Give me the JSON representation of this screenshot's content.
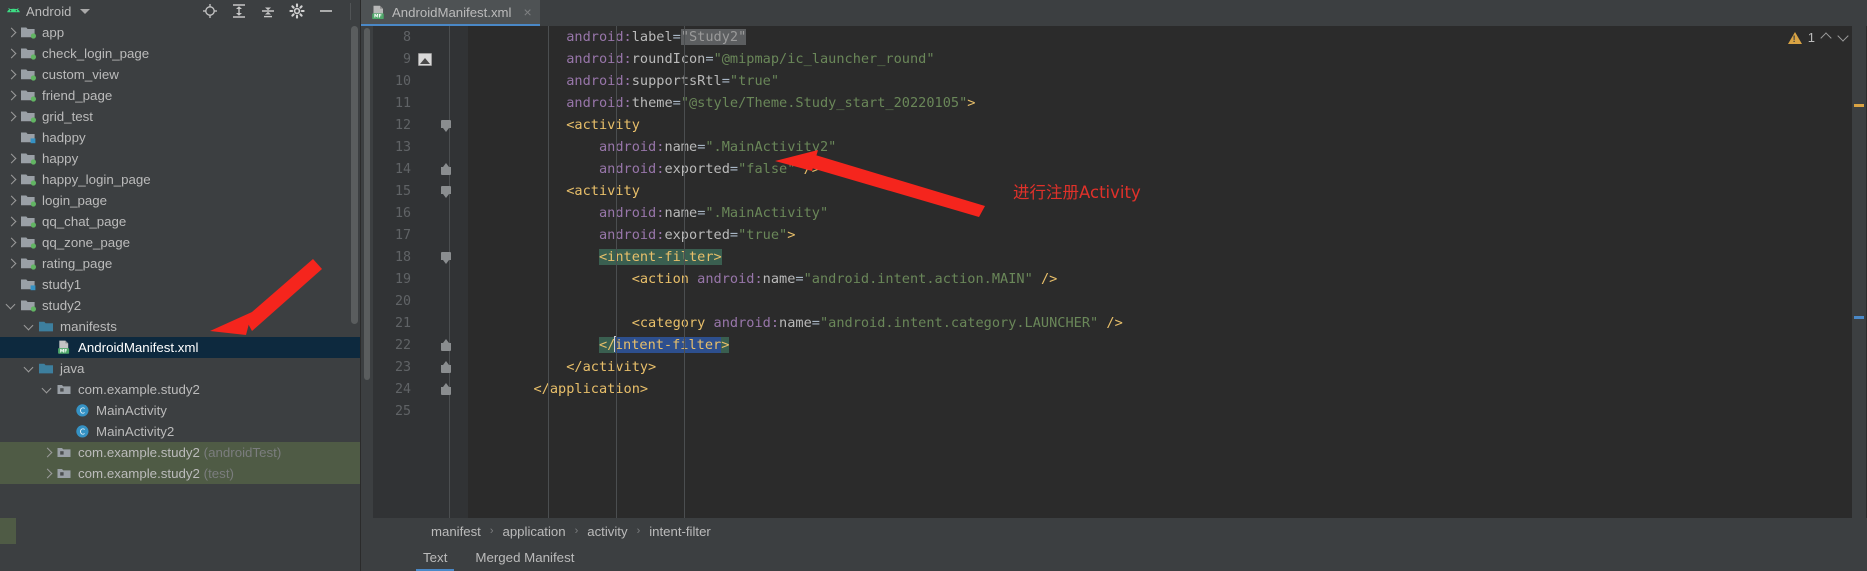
{
  "window": {
    "panel_title": "Android",
    "panel_caret": "▾"
  },
  "toolbar": {
    "icons": [
      {
        "name": "locate-target-icon",
        "glyph": "target"
      },
      {
        "name": "expand-all-icon",
        "glyph": "expand"
      },
      {
        "name": "collapse-all-icon",
        "glyph": "collapse"
      },
      {
        "name": "settings-gear-icon",
        "glyph": "gear"
      },
      {
        "name": "hide-panel-icon",
        "glyph": "minus"
      }
    ]
  },
  "sidebar": {
    "items": [
      {
        "label": "app",
        "twisty": "right",
        "icon": "module-folder-icon",
        "indent": 0,
        "state": "normal"
      },
      {
        "label": "check_login_page",
        "twisty": "right",
        "icon": "module-folder-icon",
        "indent": 0,
        "state": "normal"
      },
      {
        "label": "custom_view",
        "twisty": "right",
        "icon": "module-folder-icon",
        "indent": 0,
        "state": "normal"
      },
      {
        "label": "friend_page",
        "twisty": "right",
        "icon": "module-folder-icon",
        "indent": 0,
        "state": "normal"
      },
      {
        "label": "grid_test",
        "twisty": "right",
        "icon": "module-folder-icon",
        "indent": 0,
        "state": "normal"
      },
      {
        "label": "hadppy",
        "twisty": "none",
        "icon": "module-folder-blue-icon",
        "indent": 0,
        "state": "normal"
      },
      {
        "label": "happy",
        "twisty": "right",
        "icon": "module-folder-icon",
        "indent": 0,
        "state": "normal"
      },
      {
        "label": "happy_login_page",
        "twisty": "right",
        "icon": "module-folder-icon",
        "indent": 0,
        "state": "normal"
      },
      {
        "label": "login_page",
        "twisty": "right",
        "icon": "module-folder-icon",
        "indent": 0,
        "state": "normal"
      },
      {
        "label": "qq_chat_page",
        "twisty": "right",
        "icon": "module-folder-icon",
        "indent": 0,
        "state": "normal"
      },
      {
        "label": "qq_zone_page",
        "twisty": "right",
        "icon": "module-folder-icon",
        "indent": 0,
        "state": "normal"
      },
      {
        "label": "rating_page",
        "twisty": "right",
        "icon": "module-folder-icon",
        "indent": 0,
        "state": "normal"
      },
      {
        "label": "study1",
        "twisty": "none",
        "icon": "module-folder-blue-icon",
        "indent": 0,
        "state": "normal"
      },
      {
        "label": "study2",
        "twisty": "down",
        "icon": "module-folder-icon",
        "indent": 0,
        "state": "normal"
      },
      {
        "label": "manifests",
        "twisty": "down",
        "icon": "folder-icon",
        "indent": 1,
        "state": "normal"
      },
      {
        "label": "AndroidManifest.xml",
        "twisty": "none",
        "icon": "manifest-file-icon",
        "indent": 2,
        "state": "selected"
      },
      {
        "label": "java",
        "twisty": "down",
        "icon": "folder-icon",
        "indent": 1,
        "state": "normal"
      },
      {
        "label": "com.example.study2",
        "twisty": "down",
        "icon": "package-icon",
        "indent": 2,
        "state": "normal"
      },
      {
        "label": "MainActivity",
        "twisty": "none",
        "icon": "java-class-icon",
        "indent": 3,
        "state": "normal"
      },
      {
        "label": "MainActivity2",
        "twisty": "none",
        "icon": "java-class-icon",
        "indent": 3,
        "state": "normal"
      },
      {
        "label": "com.example.study2",
        "suffix": " (androidTest)",
        "twisty": "right",
        "icon": "package-icon",
        "indent": 2,
        "state": "testsrc"
      },
      {
        "label": "com.example.study2",
        "suffix": " (test)",
        "twisty": "right",
        "icon": "package-icon",
        "indent": 2,
        "state": "testsrc"
      }
    ]
  },
  "editor": {
    "tab": {
      "label": "AndroidManifest.xml",
      "close_glyph": "×",
      "icon": "manifest-file-icon"
    },
    "first_line_number": 8,
    "lines": [
      {
        "num": 8,
        "fold": "none",
        "gutter_icon": "none",
        "segments": [
          {
            "t": "            ",
            "c": "plain"
          },
          {
            "t": "android:",
            "c": "attr"
          },
          {
            "t": "label",
            "c": "attrns"
          },
          {
            "t": "=",
            "c": "eq"
          },
          {
            "t": "\"Study2\"",
            "c": "hl-val"
          }
        ]
      },
      {
        "num": 9,
        "fold": "none",
        "gutter_icon": "image-preview-icon",
        "segments": [
          {
            "t": "            ",
            "c": "plain"
          },
          {
            "t": "android:",
            "c": "attr"
          },
          {
            "t": "roundIcon",
            "c": "attrns"
          },
          {
            "t": "=",
            "c": "eq"
          },
          {
            "t": "\"@mipmap/ic_launcher_round\"",
            "c": "val"
          }
        ]
      },
      {
        "num": 10,
        "fold": "none",
        "gutter_icon": "none",
        "segments": [
          {
            "t": "            ",
            "c": "plain"
          },
          {
            "t": "android:",
            "c": "attr"
          },
          {
            "t": "supportsRtl",
            "c": "attrns"
          },
          {
            "t": "=",
            "c": "eq"
          },
          {
            "t": "\"true\"",
            "c": "val"
          }
        ]
      },
      {
        "num": 11,
        "fold": "none",
        "gutter_icon": "none",
        "segments": [
          {
            "t": "            ",
            "c": "plain"
          },
          {
            "t": "android:",
            "c": "attr"
          },
          {
            "t": "theme",
            "c": "attrns"
          },
          {
            "t": "=",
            "c": "eq"
          },
          {
            "t": "\"@style/Theme.Study_start_20220105\"",
            "c": "val"
          },
          {
            "t": ">",
            "c": "tag"
          }
        ]
      },
      {
        "num": 12,
        "fold": "open",
        "gutter_icon": "none",
        "segments": [
          {
            "t": "            ",
            "c": "plain"
          },
          {
            "t": "<activity",
            "c": "tag"
          }
        ]
      },
      {
        "num": 13,
        "fold": "none",
        "gutter_icon": "none",
        "segments": [
          {
            "t": "                ",
            "c": "plain"
          },
          {
            "t": "android:",
            "c": "attr"
          },
          {
            "t": "name",
            "c": "attrns"
          },
          {
            "t": "=",
            "c": "eq"
          },
          {
            "t": "\".MainActivity2\"",
            "c": "val"
          }
        ]
      },
      {
        "num": 14,
        "fold": "close",
        "gutter_icon": "none",
        "segments": [
          {
            "t": "                ",
            "c": "plain"
          },
          {
            "t": "android:",
            "c": "attr"
          },
          {
            "t": "exported",
            "c": "attrns"
          },
          {
            "t": "=",
            "c": "eq"
          },
          {
            "t": "\"false\"",
            "c": "val"
          },
          {
            "t": " ",
            "c": "plain"
          },
          {
            "t": "/>",
            "c": "tag"
          }
        ]
      },
      {
        "num": 15,
        "fold": "open",
        "gutter_icon": "none",
        "segments": [
          {
            "t": "            ",
            "c": "plain"
          },
          {
            "t": "<activity",
            "c": "tag"
          }
        ]
      },
      {
        "num": 16,
        "fold": "none",
        "gutter_icon": "none",
        "segments": [
          {
            "t": "                ",
            "c": "plain"
          },
          {
            "t": "android:",
            "c": "attr"
          },
          {
            "t": "name",
            "c": "attrns"
          },
          {
            "t": "=",
            "c": "eq"
          },
          {
            "t": "\".MainActivity\"",
            "c": "val"
          }
        ]
      },
      {
        "num": 17,
        "fold": "none",
        "gutter_icon": "none",
        "segments": [
          {
            "t": "                ",
            "c": "plain"
          },
          {
            "t": "android:",
            "c": "attr"
          },
          {
            "t": "exported",
            "c": "attrns"
          },
          {
            "t": "=",
            "c": "eq"
          },
          {
            "t": "\"true\"",
            "c": "val"
          },
          {
            "t": ">",
            "c": "tag"
          }
        ]
      },
      {
        "num": 18,
        "fold": "open",
        "gutter_icon": "none",
        "segments": [
          {
            "t": "                ",
            "c": "plain"
          },
          {
            "t": "<intent-filter>",
            "c": "tag hl-match"
          }
        ]
      },
      {
        "num": 19,
        "fold": "none",
        "gutter_icon": "none",
        "segments": [
          {
            "t": "                    ",
            "c": "plain"
          },
          {
            "t": "<action ",
            "c": "tag"
          },
          {
            "t": "android:",
            "c": "attr"
          },
          {
            "t": "name",
            "c": "attrns"
          },
          {
            "t": "=",
            "c": "eq"
          },
          {
            "t": "\"android.intent.action.MAIN\"",
            "c": "val"
          },
          {
            "t": " ",
            "c": "plain"
          },
          {
            "t": "/>",
            "c": "tag"
          }
        ]
      },
      {
        "num": 20,
        "fold": "none",
        "gutter_icon": "none",
        "segments": []
      },
      {
        "num": 21,
        "fold": "none",
        "gutter_icon": "none",
        "segments": [
          {
            "t": "                    ",
            "c": "plain"
          },
          {
            "t": "<category ",
            "c": "tag"
          },
          {
            "t": "android:",
            "c": "attr"
          },
          {
            "t": "name",
            "c": "attrns"
          },
          {
            "t": "=",
            "c": "eq"
          },
          {
            "t": "\"android.intent.category.LAUNCHER\"",
            "c": "val"
          },
          {
            "t": " ",
            "c": "plain"
          },
          {
            "t": "/>",
            "c": "tag"
          }
        ]
      },
      {
        "num": 22,
        "fold": "close",
        "gutter_icon": "none",
        "caret_after": "</",
        "segments": [
          {
            "t": "                ",
            "c": "plain"
          },
          {
            "t": "</",
            "c": "tag hl-match"
          },
          {
            "t": "intent-filter",
            "c": "tag sel"
          },
          {
            "t": ">",
            "c": "tag hl-match"
          }
        ]
      },
      {
        "num": 23,
        "fold": "close",
        "gutter_icon": "none",
        "segments": [
          {
            "t": "            ",
            "c": "plain"
          },
          {
            "t": "</activity>",
            "c": "tag"
          }
        ]
      },
      {
        "num": 24,
        "fold": "close",
        "gutter_icon": "none",
        "segments": [
          {
            "t": "        ",
            "c": "plain"
          },
          {
            "t": "</application>",
            "c": "tag"
          }
        ]
      },
      {
        "num": 25,
        "fold": "none",
        "gutter_icon": "none",
        "segments": []
      }
    ],
    "inspection": {
      "warning_count": "1",
      "warning_icon": "warning-triangle-icon",
      "prev_glyph": "^",
      "next_glyph": "v"
    },
    "breadcrumb": {
      "items": [
        "manifest",
        "application",
        "activity",
        "intent-filter"
      ],
      "separator": "›"
    },
    "bottom_tabs": [
      {
        "label": "Text",
        "active": true
      },
      {
        "label": "Merged Manifest",
        "active": false
      }
    ]
  },
  "annotations": {
    "note_text": "进行注册Activity",
    "arrow_color": "#f5251d",
    "arrows": [
      {
        "name": "arrow-to-exported-line"
      },
      {
        "name": "arrow-to-manifests-folder"
      }
    ]
  },
  "colors": {
    "panel_bg": "#3c3f41",
    "editor_bg": "#2b2b2b",
    "gutter_bg": "#313335",
    "selection_blue": "#2d4f8e",
    "tree_selection": "#0d293e",
    "tab_accent": "#4a88c7",
    "test_source_bg": "#4f5b45",
    "tag_color": "#e8bf6a",
    "attr_color": "#9876aa",
    "value_color": "#6a8759",
    "annotation_red": "#e0312a"
  }
}
